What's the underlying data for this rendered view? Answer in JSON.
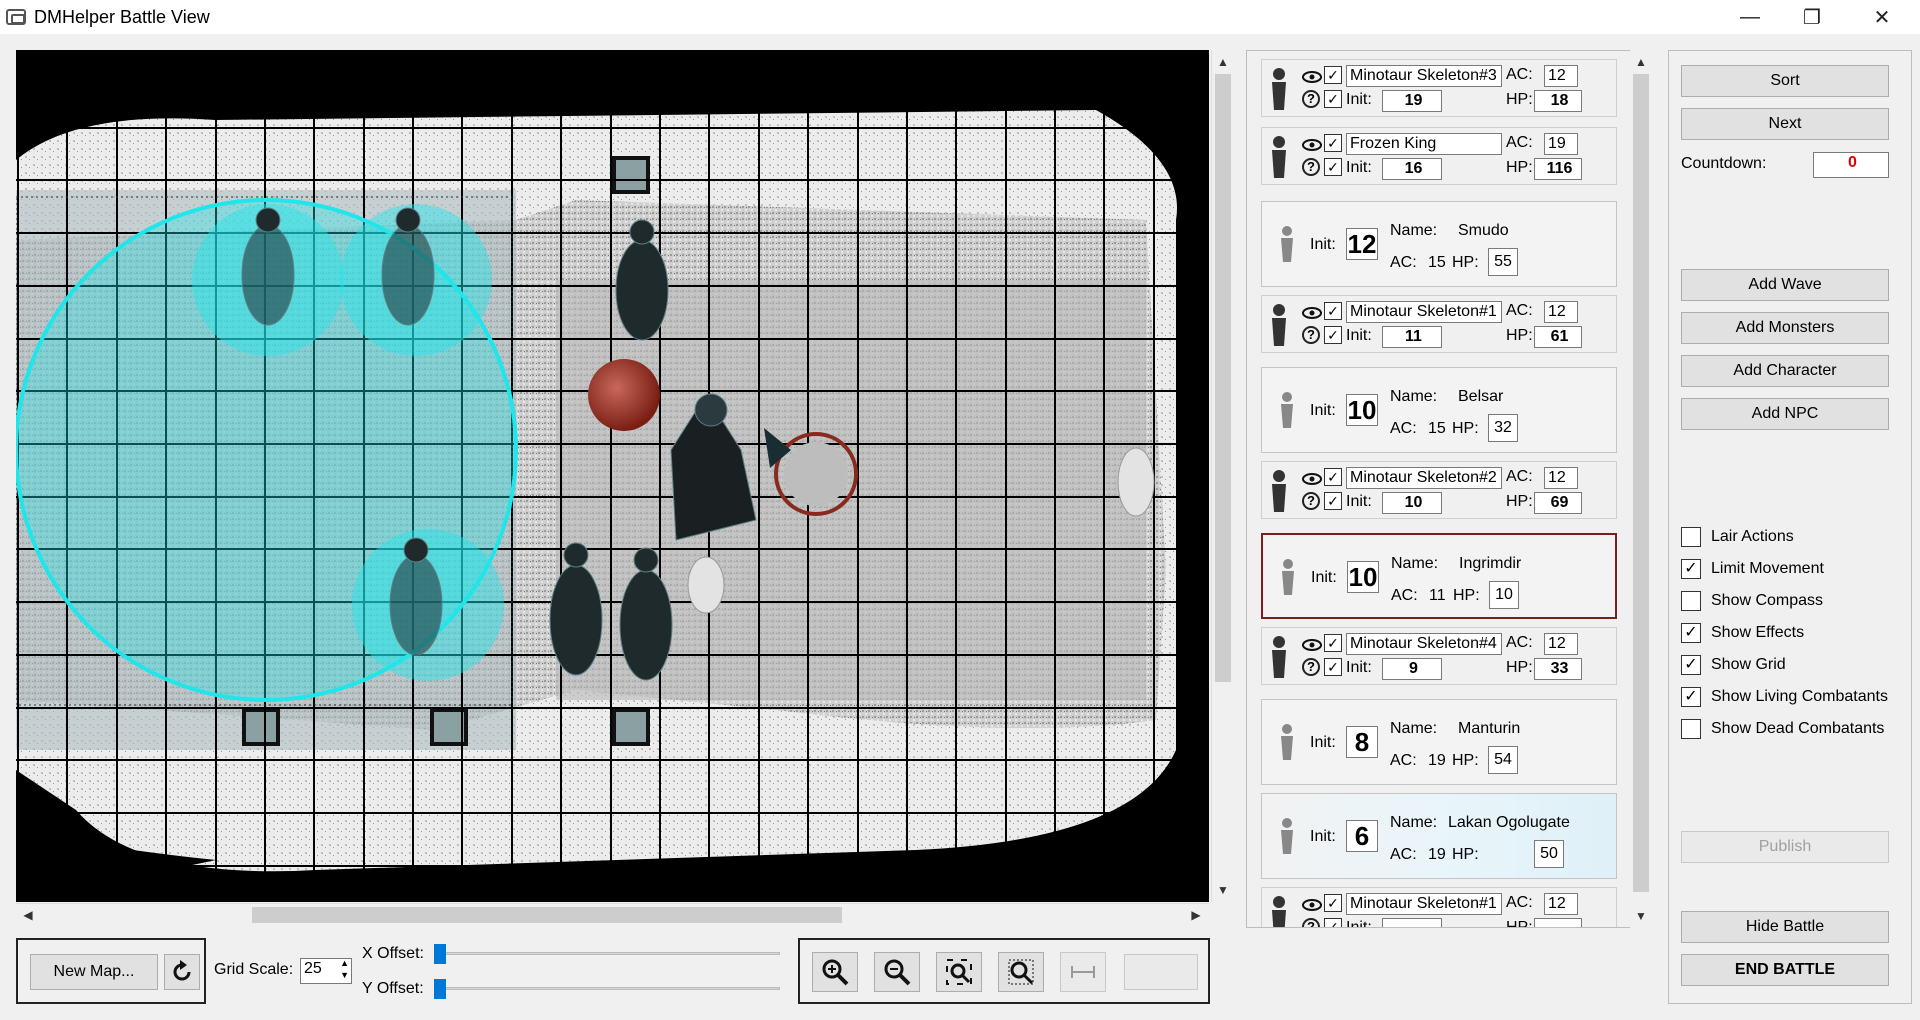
{
  "window": {
    "title": "DMHelper Battle View",
    "controls": {
      "minimize": "—",
      "maximize": "❐",
      "close": "✕"
    }
  },
  "map": {
    "grid_cols": 24,
    "grid_rows": 16
  },
  "bottom": {
    "new_map": "New Map...",
    "grid_scale_label": "Grid Scale:",
    "grid_scale_value": "25",
    "x_offset_label": "X Offset:",
    "y_offset_label": "Y Offset:"
  },
  "combatants": [
    {
      "kind": "monster",
      "name": "Minotaur Skeleton#3",
      "ac_label": "AC:",
      "ac": "12",
      "init_label": "Init:",
      "init": "19",
      "hp_label": "HP:",
      "hp": "18"
    },
    {
      "kind": "monster",
      "name": "Frozen King",
      "ac_label": "AC:",
      "ac": "19",
      "init_label": "Init:",
      "init": "16",
      "hp_label": "HP:",
      "hp": "116"
    },
    {
      "kind": "pc",
      "init_label": "Init:",
      "init": "12",
      "name_label": "Name:",
      "name": "Smudo",
      "ac_label": "AC:",
      "ac": "15",
      "hp_label": "HP:",
      "hp": "55"
    },
    {
      "kind": "monster",
      "name": "Minotaur Skeleton#1",
      "ac_label": "AC:",
      "ac": "12",
      "init_label": "Init:",
      "init": "11",
      "hp_label": "HP:",
      "hp": "61"
    },
    {
      "kind": "pc",
      "init_label": "Init:",
      "init": "10",
      "name_label": "Name:",
      "name": "Belsar",
      "ac_label": "AC:",
      "ac": "15",
      "hp_label": "HP:",
      "hp": "32"
    },
    {
      "kind": "monster",
      "name": "Minotaur Skeleton#2",
      "ac_label": "AC:",
      "ac": "12",
      "init_label": "Init:",
      "init": "10",
      "hp_label": "HP:",
      "hp": "69"
    },
    {
      "kind": "pc",
      "active": true,
      "init_label": "Init:",
      "init": "10",
      "name_label": "Name:",
      "name": "Ingrimdir",
      "ac_label": "AC:",
      "ac": "11",
      "hp_label": "HP:",
      "hp": "10"
    },
    {
      "kind": "monster",
      "name": "Minotaur Skeleton#4",
      "ac_label": "AC:",
      "ac": "12",
      "init_label": "Init:",
      "init": "9",
      "hp_label": "HP:",
      "hp": "33"
    },
    {
      "kind": "pc",
      "init_label": "Init:",
      "init": "8",
      "name_label": "Name:",
      "name": "Manturin",
      "ac_label": "AC:",
      "ac": "19",
      "hp_label": "HP:",
      "hp": "54"
    },
    {
      "kind": "pc",
      "glow": true,
      "init_label": "Init:",
      "init": "6",
      "name_label": "Name:",
      "name": "Lakan Ogolugate",
      "ac_label": "AC:",
      "ac": "19",
      "hp_label": "HP:",
      "hp": "50"
    },
    {
      "kind": "monster",
      "name": "Minotaur Skeleton#1",
      "ac_label": "AC:",
      "ac": "12",
      "init_label": "Init:",
      "init": "",
      "hp_label": "HP:",
      "hp": ""
    }
  ],
  "right_panel": {
    "sort": "Sort",
    "next": "Next",
    "countdown_label": "Countdown:",
    "countdown_value": "0",
    "add_wave": "Add Wave",
    "add_monsters": "Add Monsters",
    "add_character": "Add Character",
    "add_npc": "Add NPC",
    "options": [
      {
        "label": "Lair Actions",
        "checked": false
      },
      {
        "label": "Limit Movement",
        "checked": true
      },
      {
        "label": "Show Compass",
        "checked": false
      },
      {
        "label": "Show Effects",
        "checked": true
      },
      {
        "label": "Show Grid",
        "checked": true
      },
      {
        "label": "Show Living Combatants",
        "checked": true
      },
      {
        "label": "Show Dead Combatants",
        "checked": false
      }
    ],
    "publish": "Publish",
    "hide_battle": "Hide Battle",
    "end_battle": "END BATTLE"
  },
  "colors": {
    "effect": "#1ee6ea",
    "countdown": "#e00000",
    "active_border": "#7a1f1f"
  }
}
